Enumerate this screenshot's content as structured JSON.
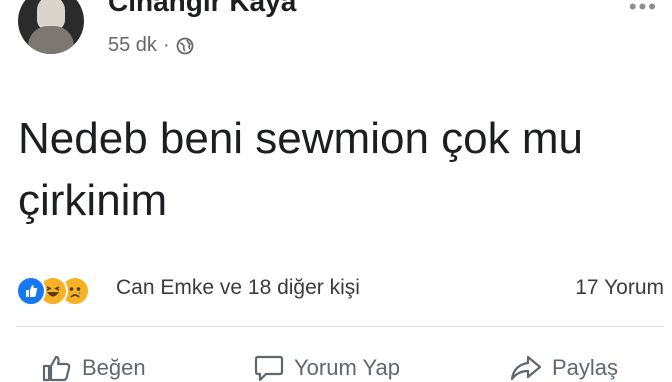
{
  "post": {
    "author": "Cihangir Kaya",
    "time": "55 dk",
    "separator": "·",
    "privacy_icon": "globe-icon",
    "more_icon": "more-icon",
    "text": "Nedeb beni sewmion çok mu çirkinim",
    "reactions": {
      "icons": [
        "like-reaction",
        "haha-reaction",
        "sad-reaction"
      ],
      "summary": "Can Emke ve 18 diğer kişi",
      "comments": "17 Yorum"
    },
    "actions": {
      "like": "Beğen",
      "comment": "Yorum Yap",
      "share": "Paylaş"
    },
    "colors": {
      "like_blue": "#1877f2",
      "emoji_yellow": "#f7b125",
      "secondary_text": "#65676b"
    }
  }
}
